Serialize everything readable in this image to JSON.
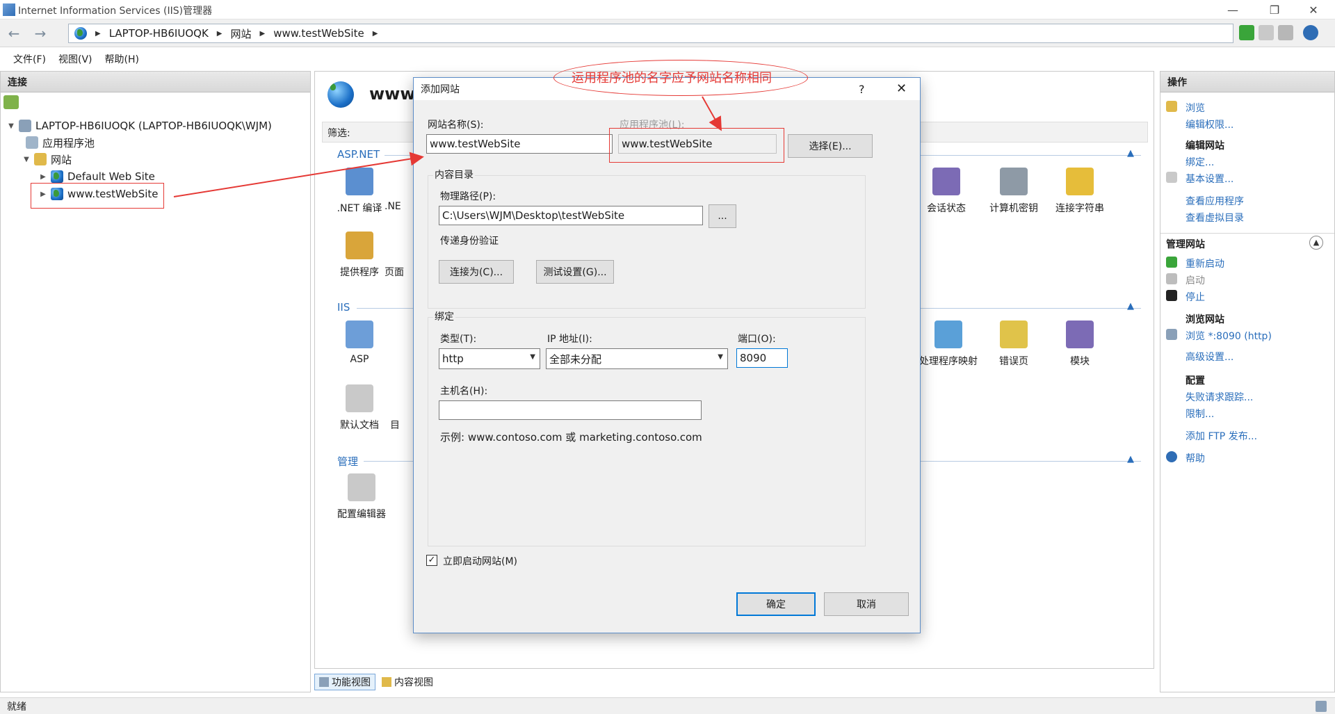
{
  "window": {
    "title": "Internet Information Services (IIS)管理器"
  },
  "address": {
    "crumbs": [
      "LAPTOP-HB6IUOQK",
      "网站",
      "www.testWebSite"
    ]
  },
  "menu": {
    "file": "文件(F)",
    "view": "视图(V)",
    "help": "帮助(H)"
  },
  "left_pane": {
    "header": "连接",
    "tree": {
      "server": "LAPTOP-HB6IUOQK (LAPTOP-HB6IUOQK\\WJM)",
      "app_pools": "应用程序池",
      "sites": "网站",
      "default_site": "Default Web Site",
      "test_site": "www.testWebSite"
    }
  },
  "center": {
    "title": "www.",
    "filter_label": "筛选:",
    "sections": {
      "aspnet": "ASP.NET",
      "iis": "IIS",
      "management": "管理"
    },
    "features": {
      "net_compile": ".NET 编译",
      "net_partial": ".NE",
      "providers": "提供程序",
      "pages_partial": "页面",
      "session_state": "会话状态",
      "machine_key": "计算机密钥",
      "conn_strings": "连接字符串",
      "asp": "ASP",
      "default_doc": "默认文档",
      "dir_partial": "目",
      "handler_mappings": "处理程序映射",
      "error_pages": "错误页",
      "modules": "模块",
      "config_editor": "配置编辑器"
    }
  },
  "view_tabs": {
    "features": "功能视图",
    "content": "内容视图"
  },
  "status": {
    "text": "就绪"
  },
  "right_pane": {
    "header": "操作",
    "browse": "浏览",
    "edit_permissions": "编辑权限...",
    "edit_site_heading": "编辑网站",
    "bindings": "绑定...",
    "basic_settings": "基本设置...",
    "view_apps": "查看应用程序",
    "view_vdirs": "查看虚拟目录",
    "manage_site_heading": "管理网站",
    "restart": "重新启动",
    "start": "启动",
    "stop": "停止",
    "browse_site_heading": "浏览网站",
    "browse_8090": "浏览 *:8090 (http)",
    "advanced_settings": "高级设置...",
    "config_heading": "配置",
    "failed_request": "失败请求跟踪...",
    "limits": "限制...",
    "add_ftp": "添加 FTP 发布...",
    "help": "帮助"
  },
  "dialog": {
    "title": "添加网站",
    "help_glyph": "?",
    "site_name_label": "网站名称(S):",
    "site_name_value": "www.testWebSite",
    "app_pool_label": "应用程序池(L):",
    "app_pool_value": "www.testWebSite",
    "select_btn": "选择(E)...",
    "content_dir_label": "内容目录",
    "physical_path_label": "物理路径(P):",
    "physical_path_value": "C:\\Users\\WJM\\Desktop\\testWebSite",
    "browse_btn": "...",
    "passthrough_label": "传递身份验证",
    "connect_as_btn": "连接为(C)...",
    "test_settings_btn": "测试设置(G)...",
    "binding_label": "绑定",
    "type_label": "类型(T):",
    "type_value": "http",
    "ip_label": "IP 地址(I):",
    "ip_value": "全部未分配",
    "port_label": "端口(O):",
    "port_value": "8090",
    "hostname_label": "主机名(H):",
    "hostname_value": "",
    "example_text": "示例: www.contoso.com 或 marketing.contoso.com",
    "start_now_label": "立即启动网站(M)",
    "start_now_checked": true,
    "ok_btn": "确定",
    "cancel_btn": "取消"
  },
  "annotation": {
    "note": "运用程序池的名字应予网站名称相同",
    "color": "#e53935"
  }
}
